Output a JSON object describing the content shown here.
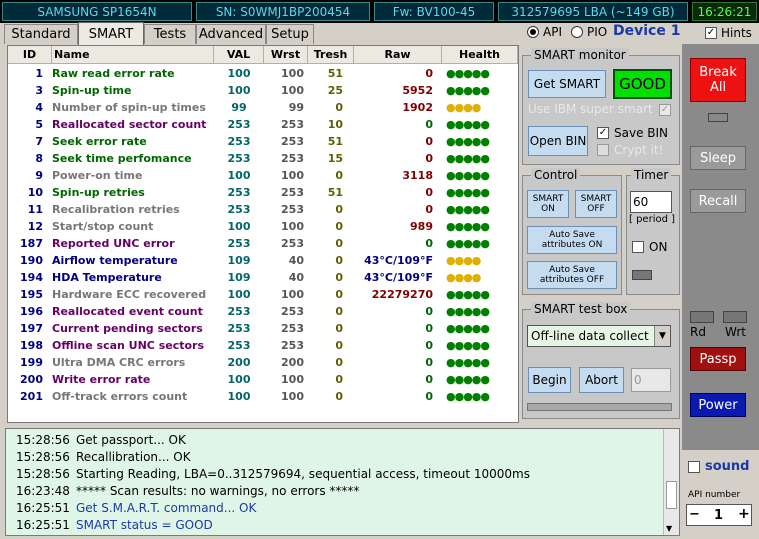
{
  "status_bar": {
    "model": "SAMSUNG SP1654N",
    "serial": "SN: S0WMJ1BP200454",
    "firmware": "Fw: BV100-45",
    "lba": "312579695 LBA (~149 GB)",
    "time": "16:26:21"
  },
  "tabs": [
    {
      "label": "Standard"
    },
    {
      "label": "SMART",
      "active": true
    },
    {
      "label": "Tests"
    },
    {
      "label": "Advanced"
    },
    {
      "label": "Setup"
    }
  ],
  "mode": {
    "api_label": "API",
    "pio_label": "PIO",
    "api_selected": true,
    "device_label": "Device 1",
    "hints_label": "Hints",
    "hints_checked": true
  },
  "table": {
    "headers": [
      "ID",
      "Name",
      "VAL",
      "Wrst",
      "Tresh",
      "Raw",
      "Health"
    ],
    "rows": [
      {
        "id": "1",
        "name": "Raw read error rate",
        "val": "100",
        "wrst": "100",
        "tresh": "51",
        "raw": "0",
        "health": "●●●●●",
        "name_color": "#006600",
        "raw_color": "#800000",
        "health_color": "#008000"
      },
      {
        "id": "3",
        "name": "Spin-up time",
        "val": "100",
        "wrst": "100",
        "tresh": "25",
        "raw": "5952",
        "health": "●●●●●",
        "name_color": "#006600",
        "raw_color": "#800000",
        "health_color": "#008000"
      },
      {
        "id": "4",
        "name": "Number of spin-up times",
        "val": "99",
        "wrst": "99",
        "tresh": "0",
        "raw": "1902",
        "health": "●●●●",
        "name_color": "#777777",
        "raw_color": "#800000",
        "health_color": "#e0b000"
      },
      {
        "id": "5",
        "name": "Reallocated sector count",
        "val": "253",
        "wrst": "253",
        "tresh": "10",
        "raw": "0",
        "health": "●●●●●",
        "name_color": "#660066",
        "raw_color": "#006600",
        "health_color": "#008000"
      },
      {
        "id": "7",
        "name": "Seek error rate",
        "val": "253",
        "wrst": "253",
        "tresh": "51",
        "raw": "0",
        "health": "●●●●●",
        "name_color": "#006600",
        "raw_color": "#800000",
        "health_color": "#008000"
      },
      {
        "id": "8",
        "name": "Seek time perfomance",
        "val": "253",
        "wrst": "253",
        "tresh": "15",
        "raw": "0",
        "health": "●●●●●",
        "name_color": "#006600",
        "raw_color": "#800000",
        "health_color": "#008000"
      },
      {
        "id": "9",
        "name": "Power-on time",
        "val": "100",
        "wrst": "100",
        "tresh": "0",
        "raw": "3118",
        "health": "●●●●●",
        "name_color": "#777777",
        "raw_color": "#800000",
        "health_color": "#008000"
      },
      {
        "id": "10",
        "name": "Spin-up retries",
        "val": "253",
        "wrst": "253",
        "tresh": "51",
        "raw": "0",
        "health": "●●●●●",
        "name_color": "#006600",
        "raw_color": "#800000",
        "health_color": "#008000"
      },
      {
        "id": "11",
        "name": "Recalibration retries",
        "val": "253",
        "wrst": "253",
        "tresh": "0",
        "raw": "0",
        "health": "●●●●●",
        "name_color": "#777777",
        "raw_color": "#800000",
        "health_color": "#008000"
      },
      {
        "id": "12",
        "name": "Start/stop count",
        "val": "100",
        "wrst": "100",
        "tresh": "0",
        "raw": "989",
        "health": "●●●●●",
        "name_color": "#777777",
        "raw_color": "#800000",
        "health_color": "#008000"
      },
      {
        "id": "187",
        "name": "Reported UNC error",
        "val": "253",
        "wrst": "253",
        "tresh": "0",
        "raw": "0",
        "health": "●●●●●",
        "name_color": "#660066",
        "raw_color": "#006600",
        "health_color": "#008000"
      },
      {
        "id": "190",
        "name": "Airflow temperature",
        "val": "109",
        "wrst": "40",
        "tresh": "0",
        "raw": "43°C/109°F",
        "health": "●●●●",
        "name_color": "#000080",
        "raw_color": "#000080",
        "health_color": "#e0b000"
      },
      {
        "id": "194",
        "name": "HDA Temperature",
        "val": "109",
        "wrst": "40",
        "tresh": "0",
        "raw": "43°C/109°F",
        "health": "●●●●",
        "name_color": "#000080",
        "raw_color": "#000080",
        "health_color": "#e0b000"
      },
      {
        "id": "195",
        "name": "Hardware ECC recovered",
        "val": "100",
        "wrst": "100",
        "tresh": "0",
        "raw": "22279270",
        "health": "●●●●●",
        "name_color": "#777777",
        "raw_color": "#800000",
        "health_color": "#008000"
      },
      {
        "id": "196",
        "name": "Reallocated event count",
        "val": "253",
        "wrst": "253",
        "tresh": "0",
        "raw": "0",
        "health": "●●●●●",
        "name_color": "#660066",
        "raw_color": "#006600",
        "health_color": "#008000"
      },
      {
        "id": "197",
        "name": "Current pending sectors",
        "val": "253",
        "wrst": "253",
        "tresh": "0",
        "raw": "0",
        "health": "●●●●●",
        "name_color": "#660066",
        "raw_color": "#006600",
        "health_color": "#008000"
      },
      {
        "id": "198",
        "name": "Offline scan UNC sectors",
        "val": "253",
        "wrst": "253",
        "tresh": "0",
        "raw": "0",
        "health": "●●●●●",
        "name_color": "#660066",
        "raw_color": "#006600",
        "health_color": "#008000"
      },
      {
        "id": "199",
        "name": "Ultra DMA CRC errors",
        "val": "200",
        "wrst": "200",
        "tresh": "0",
        "raw": "0",
        "health": "●●●●●",
        "name_color": "#777777",
        "raw_color": "#006600",
        "health_color": "#008000"
      },
      {
        "id": "200",
        "name": "Write error rate",
        "val": "100",
        "wrst": "100",
        "tresh": "0",
        "raw": "0",
        "health": "●●●●●",
        "name_color": "#660066",
        "raw_color": "#006600",
        "health_color": "#008000"
      },
      {
        "id": "201",
        "name": "Off-track errors count",
        "val": "100",
        "wrst": "100",
        "tresh": "0",
        "raw": "0",
        "health": "●●●●●",
        "name_color": "#777777",
        "raw_color": "#006600",
        "health_color": "#008000"
      }
    ]
  },
  "smart_monitor": {
    "title": "SMART monitor",
    "get_smart": "Get SMART",
    "status": "GOOD",
    "ibm_label": "Use IBM super smart",
    "open_bin": "Open BIN",
    "save_bin": "Save BIN",
    "crypt_it": "Crypt it!"
  },
  "control": {
    "title": "Control",
    "smart_on": "SMART ON",
    "smart_off": "SMART OFF",
    "autosave_on": "Auto Save attributes ON",
    "autosave_off": "Auto Save attributes OFF"
  },
  "timer": {
    "title": "Timer",
    "value": "60",
    "period": "[ period ]",
    "on_label": "ON"
  },
  "test_box": {
    "title": "SMART test box",
    "selected": "Off-line data collect",
    "begin": "Begin",
    "abort": "Abort",
    "count": "0"
  },
  "right_panel": {
    "break_all": "Break All",
    "sleep": "Sleep",
    "recall": "Recall",
    "rd": "Rd",
    "wrt": "Wrt",
    "passp": "Passp",
    "power": "Power",
    "sound": "sound",
    "api_number_label": "API number",
    "api_number": "1",
    "minus": "−",
    "plus": "+"
  },
  "log": [
    {
      "time": "15:28:56",
      "msg": "Get passport... OK",
      "color": "#000000"
    },
    {
      "time": "15:28:56",
      "msg": "Recallibration... OK",
      "color": "#000000"
    },
    {
      "time": "15:28:56",
      "msg": "Starting Reading, LBA=0..312579694, sequential access, timeout 10000ms",
      "color": "#000000"
    },
    {
      "time": "16:23:48",
      "msg": "***** Scan results: no warnings, no errors *****",
      "color": "#000000"
    },
    {
      "time": "16:25:51",
      "msg": "Get S.M.A.R.T. command... OK",
      "color": "#1a3aa8"
    },
    {
      "time": "16:25:51",
      "msg": "SMART status = GOOD",
      "color": "#1a3aa8"
    }
  ]
}
